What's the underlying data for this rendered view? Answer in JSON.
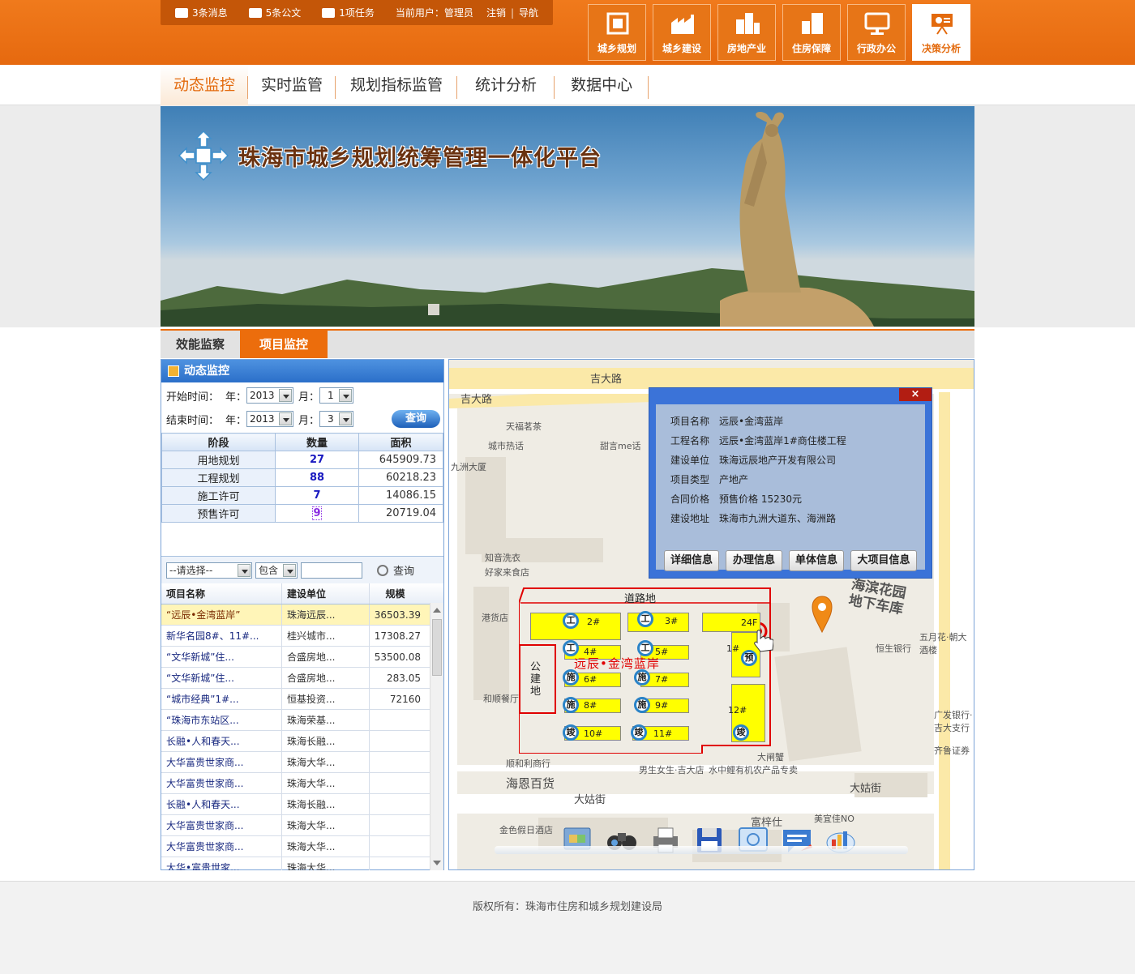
{
  "topbar": {
    "messages": "3条消息",
    "notices": "5条公文",
    "tasks": "1项任务",
    "current_user_label": "当前用户：管理员",
    "logout": "注销",
    "separator": "|",
    "navigate": "导航"
  },
  "modules": [
    {
      "label": "城乡规划",
      "icon": "planning-icon"
    },
    {
      "label": "城乡建设",
      "icon": "construction-icon"
    },
    {
      "label": "房地产业",
      "icon": "realestate-icon"
    },
    {
      "label": "住房保障",
      "icon": "housing-icon"
    },
    {
      "label": "行政办公",
      "icon": "office-icon"
    },
    {
      "label": "决策分析",
      "icon": "decision-icon",
      "active": true
    }
  ],
  "main_nav": [
    "动态监控",
    "实时监管",
    "规划指标监管",
    "统计分析",
    "数据中心"
  ],
  "banner": {
    "title": "珠海市城乡规划统筹管理一体化平台"
  },
  "sub_tabs": [
    "效能监察",
    "项目监控"
  ],
  "left_panel": {
    "title": "动态监控",
    "start_label": "开始时间：",
    "end_label": "结束时间：",
    "year_label": "年：",
    "month_label": "月：",
    "start_year": "2013",
    "start_month": "1",
    "end_year": "2013",
    "end_month": "3",
    "query_button": "查询",
    "stats_headers": [
      "阶段",
      "数量",
      "面积"
    ],
    "stats_rows": [
      {
        "stage": "用地规划",
        "count": "27",
        "area": "645909.73"
      },
      {
        "stage": "工程规划",
        "count": "88",
        "area": "60218.23"
      },
      {
        "stage": "施工许可",
        "count": "7",
        "area": "14086.15"
      },
      {
        "stage": "预售许可",
        "count": "9",
        "area": "20719.04"
      }
    ],
    "filter_select": "--请选择--",
    "filter_mode": "包含",
    "filter_query": "查询",
    "proj_headers": [
      "项目名称",
      "建设单位",
      "规模"
    ],
    "proj_rows": [
      {
        "name": "“远辰•金湾蓝岸”",
        "unit": "珠海远辰...",
        "scale": "36503.39"
      },
      {
        "name": "新华名园8#、11#...",
        "unit": "桂兴城市...",
        "scale": "17308.27"
      },
      {
        "name": "“文华新城”住...",
        "unit": "合盛房地...",
        "scale": "53500.08"
      },
      {
        "name": "“文华新城”住...",
        "unit": "合盛房地...",
        "scale": "283.05"
      },
      {
        "name": "“城市经典”1#...",
        "unit": "恒基投资...",
        "scale": "72160"
      },
      {
        "name": "“珠海市东站区...",
        "unit": "珠海荣基...",
        "scale": ""
      },
      {
        "name": "长融•人和春天...",
        "unit": "珠海长融...",
        "scale": ""
      },
      {
        "name": "大华富贵世家商...",
        "unit": "珠海大华...",
        "scale": ""
      },
      {
        "name": "大华富贵世家商...",
        "unit": "珠海大华...",
        "scale": ""
      },
      {
        "name": "长融•人和春天...",
        "unit": "珠海长融...",
        "scale": ""
      },
      {
        "name": "大华富贵世家商...",
        "unit": "珠海大华...",
        "scale": ""
      },
      {
        "name": "大华富贵世家商...",
        "unit": "珠海大华...",
        "scale": ""
      },
      {
        "name": "大华•富贵世家...",
        "unit": "珠海大华...",
        "scale": ""
      }
    ]
  },
  "map": {
    "roads": [
      "吉大路",
      "吉大路",
      "大姑街",
      "大姑街"
    ],
    "pois": [
      "天福茗茶",
      "城市热话",
      "甜言me话",
      "九洲大厦",
      "知音洗衣",
      "好家来食店",
      "港货店",
      "和顺餐厅",
      "顺和利商行",
      "海恩百货",
      "男生女生·吉大店",
      "水中鲤有机农产品专卖",
      "大闸蟹",
      "金色假日酒店",
      "富梓仕",
      "美宜佳NO",
      "恒生银行",
      "五月花·朝大酒楼",
      "广发银行·吉大支行",
      "齐鲁证券"
    ],
    "garage_label": "海滨花园地下车库",
    "popup": {
      "close": "×",
      "fields": [
        {
          "label": "项目名称",
          "value": "远辰•金湾蓝岸"
        },
        {
          "label": "工程名称",
          "value": "远辰•金湾蓝岸1#商住楼工程"
        },
        {
          "label": "建设单位",
          "value": "珠海远辰地产开发有限公司"
        },
        {
          "label": "项目类型",
          "value": "产地产"
        },
        {
          "label": "合同价格",
          "value": "预售价格 15230元"
        },
        {
          "label": "建设地址",
          "value": "珠海市九洲大道东、海洲路"
        }
      ],
      "buttons": [
        "详细信息",
        "办理信息",
        "单体信息",
        "大项目信息"
      ]
    },
    "site": {
      "road_label": "道路地",
      "public_label": "公建地",
      "project_label": "远辰•金湾蓝岸",
      "buildings": [
        "2#",
        "3#",
        "24F",
        "4#",
        "5#",
        "1#",
        "6#",
        "7#",
        "8#",
        "9#",
        "12#",
        "10#",
        "11#"
      ],
      "markers": [
        "工",
        "工",
        "工",
        "工",
        "预",
        "施",
        "施",
        "施",
        "施",
        "竣",
        "竣",
        "竣"
      ]
    },
    "tools": [
      "folder-icon",
      "binoculars-icon",
      "printer-icon",
      "save-icon",
      "map-extent-icon",
      "message-icon",
      "chart-icon"
    ]
  },
  "footer": {
    "copyright": "版权所有：珠海市住房和城乡规划建设局"
  },
  "colors": {
    "brand": "#ec6d0c",
    "header": "#e6690f",
    "accent_blue": "#2b6fc9",
    "highlight": "#ffff00"
  }
}
